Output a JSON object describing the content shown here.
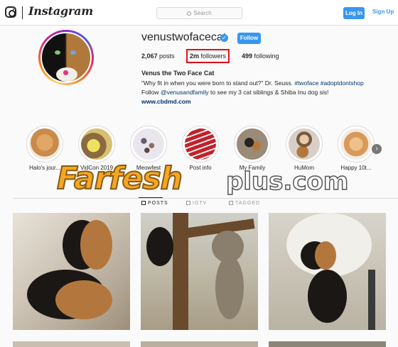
{
  "nav": {
    "brand": "Instagram",
    "search_placeholder": "Search",
    "login_label": "Log In",
    "signup_label": "Sign Up"
  },
  "profile": {
    "username": "venustwofacecat",
    "follow_label": "Follow",
    "stats": {
      "posts_count": "2,067",
      "posts_label": "posts",
      "followers_count": "2m",
      "followers_label": "followers",
      "following_count": "499",
      "following_label": "following"
    },
    "full_name": "Venus the Two Face Cat",
    "bio_line1_text": "\"Why fit in when you were born to stand out?\" Dr. Seuss. ",
    "bio_tags": "#twoface #adoptdontshop",
    "bio_line2_prefix": "Follow ",
    "bio_mention": "@venusandfamily",
    "bio_line2_suffix": " to see my 3 cat siblings & Shiba Inu dog sis!",
    "website": "www.cbdmd.com"
  },
  "highlights": [
    {
      "label": "Halo's jour...",
      "color": "#c98b4a"
    },
    {
      "label": "VidCon 2019",
      "color": "#d8c070"
    },
    {
      "label": "Meowfest",
      "color": "#e6e0ea"
    },
    {
      "label": "Post info",
      "color": "#c3202a"
    },
    {
      "label": "My Family",
      "color": "#9a8a78"
    },
    {
      "label": "HuMom",
      "color": "#b59a80"
    },
    {
      "label": "Happy 10t...",
      "color": "#d89a5a"
    }
  ],
  "watermark": {
    "main": "Farfesh",
    "suffix": "plus.com"
  },
  "tabs": [
    {
      "label": "POSTS",
      "active": true
    },
    {
      "label": "IGTV",
      "active": false
    },
    {
      "label": "TAGGED",
      "active": false
    }
  ],
  "colors": {
    "accent": "#3897f0",
    "highlight_box": "#e0101a",
    "link": "#003569"
  }
}
